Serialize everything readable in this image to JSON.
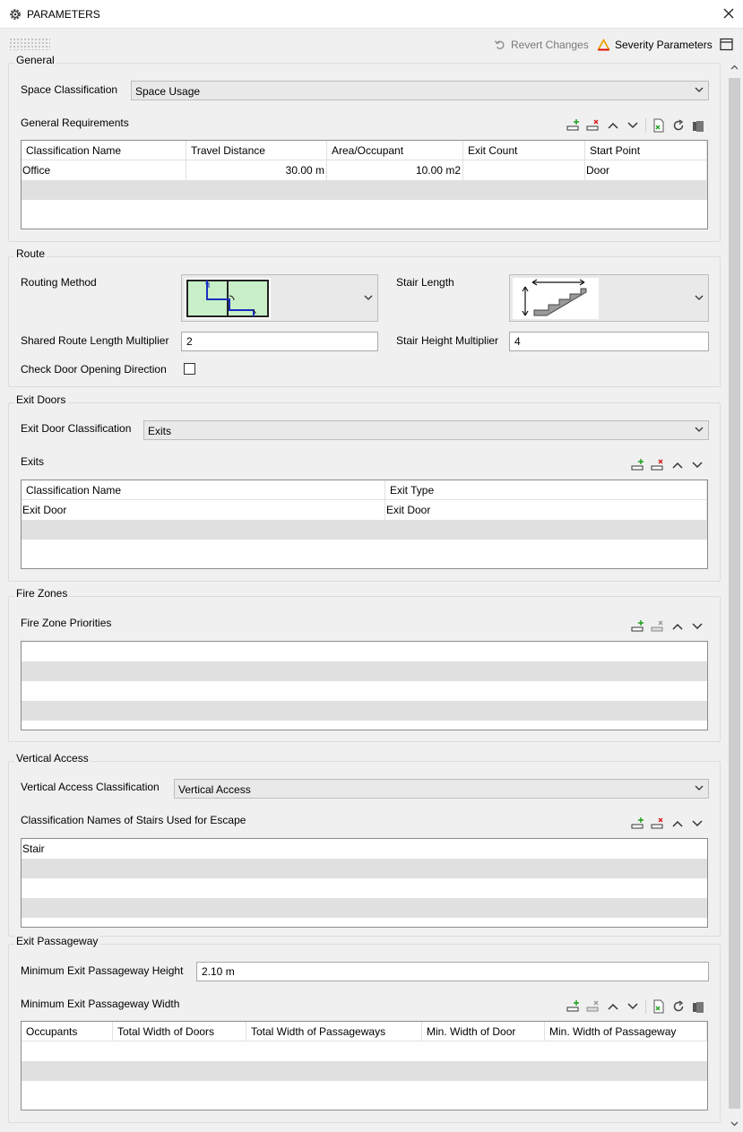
{
  "window": {
    "title": "PARAMETERS",
    "close_icon": "close-icon"
  },
  "toolbar": {
    "revert_label": "Revert Changes",
    "severity_label": "Severity Parameters",
    "severity_color": "#e8a100"
  },
  "general": {
    "title": "General",
    "space_classification_label": "Space Classification",
    "space_classification_value": "Space Usage",
    "requirements_label": "General Requirements",
    "table": {
      "columns": [
        "Classification Name",
        "Travel Distance",
        "Area/Occupant",
        "Exit Count",
        "Start Point"
      ],
      "rows": [
        [
          "Office",
          "30.00 m",
          "10.00 m2",
          "",
          "Door"
        ]
      ]
    }
  },
  "route": {
    "title": "Route",
    "routing_method_label": "Routing Method",
    "stair_length_label": "Stair Length",
    "shared_multiplier_label": "Shared Route Length Multiplier",
    "shared_multiplier_value": "2",
    "stair_height_label": "Stair Height Multiplier",
    "stair_height_value": "4",
    "check_door_label": "Check Door Opening Direction",
    "check_door_checked": false
  },
  "exit_doors": {
    "title": "Exit Doors",
    "classification_label": "Exit Door Classification",
    "classification_value": "Exits",
    "exits_label": "Exits",
    "table": {
      "columns": [
        "Classification Name",
        "Exit Type"
      ],
      "rows": [
        [
          "Exit Door",
          "Exit Door"
        ]
      ]
    }
  },
  "fire_zones": {
    "title": "Fire Zones",
    "priorities_label": "Fire Zone Priorities"
  },
  "vertical_access": {
    "title": "Vertical Access",
    "classification_label": "Vertical Access Classification",
    "classification_value": "Vertical Access",
    "stairs_label": "Classification Names of Stairs Used for Escape",
    "stairs": [
      "Stair"
    ]
  },
  "exit_passageway": {
    "title": "Exit Passageway",
    "min_height_label": "Minimum Exit Passageway Height",
    "min_height_value": "2.10 m",
    "min_width_label": "Minimum Exit Passageway Width",
    "table": {
      "columns": [
        "Occupants",
        "Total Width of Doors",
        "Total Width of Passageways",
        "Min. Width of Door",
        "Min. Width of Passageway"
      ]
    }
  }
}
